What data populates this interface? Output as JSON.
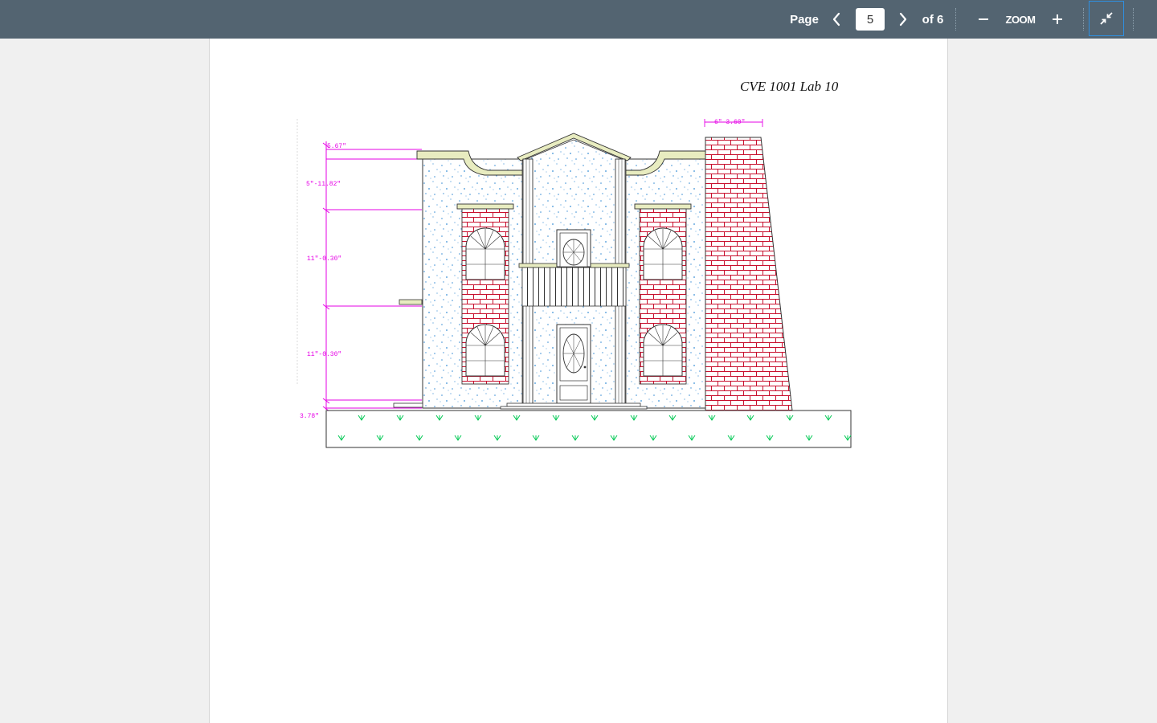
{
  "toolbar": {
    "page_label": "Page",
    "current_page": "5",
    "total_pages_label": "of 6",
    "zoom_label": "ZOOM",
    "icons": {
      "previous": "chevron-left-icon",
      "next": "chevron-right-icon",
      "zoom_out": "minus-icon",
      "zoom_in": "plus-icon",
      "collapse": "collapse-arrows-icon"
    },
    "background_color": "#536471",
    "active_border_color": "#2f8fe0"
  },
  "document": {
    "title": "CVE 1001 Lab 10",
    "dimensions": {
      "top_width": "6\"-3.60\"",
      "parapet": "5.67\"",
      "roof_band": "5\"-11.82\"",
      "upper_floor": "11\"-0.30\"",
      "lower_floor": "11\"-0.30\"",
      "plinth": "3.78\""
    },
    "colors": {
      "dimension_lines": "#e600e6",
      "brick": "#c8102e",
      "grass": "#00c853",
      "stucco_dots": "#3b8fd6",
      "trim": "#e8ecc0"
    }
  }
}
